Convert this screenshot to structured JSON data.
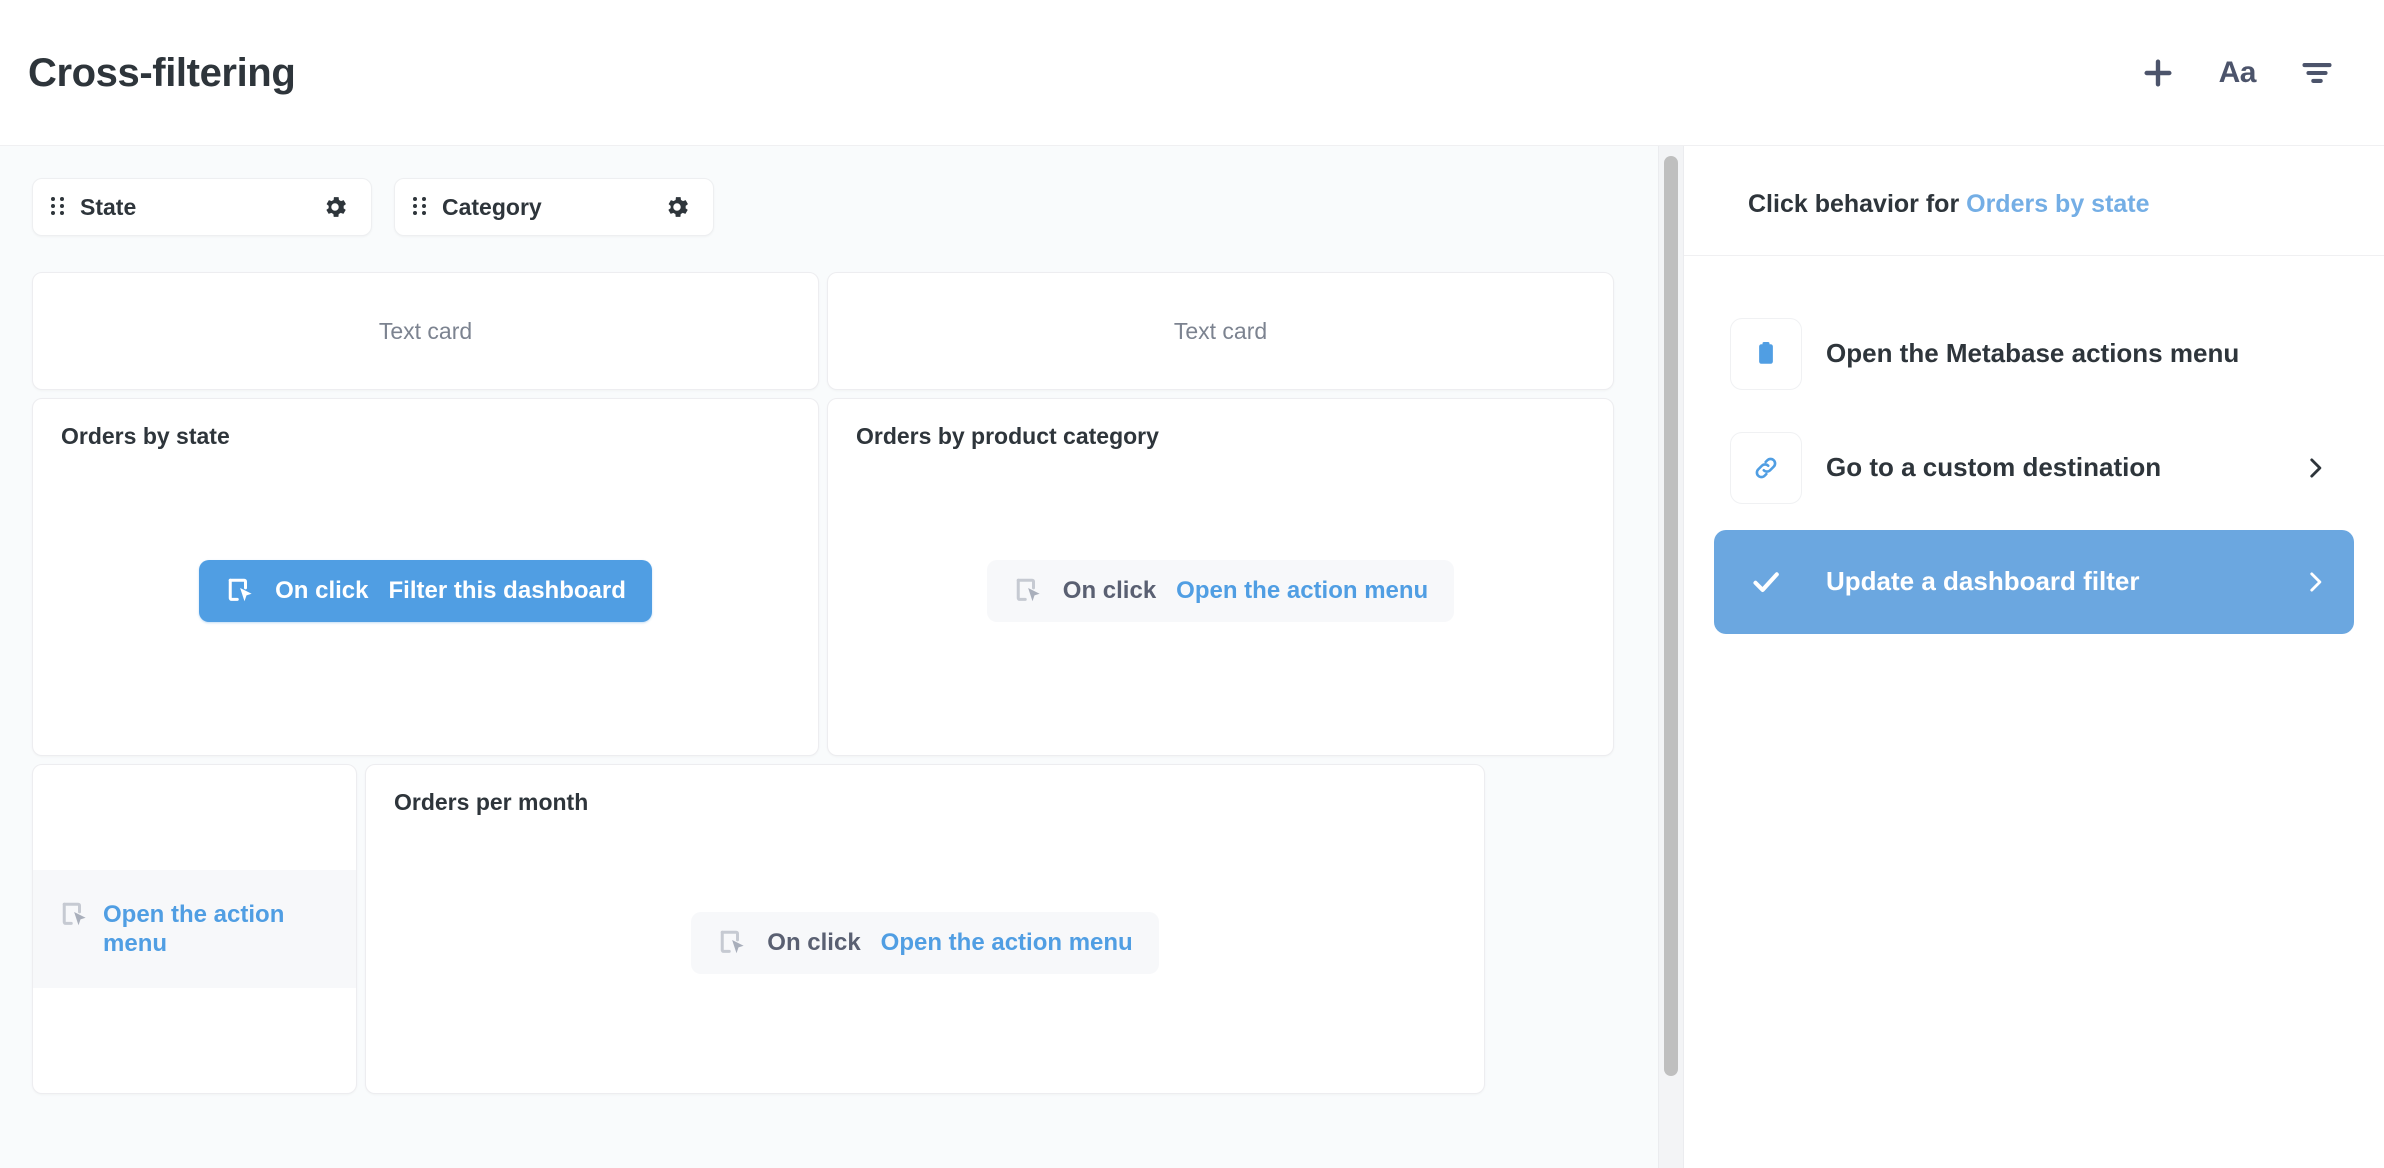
{
  "header": {
    "title": "Cross-filtering",
    "actions": [
      {
        "name": "add-icon",
        "label": "+"
      },
      {
        "name": "text-card-icon",
        "label": "Aa"
      },
      {
        "name": "filter-icon",
        "label": ""
      }
    ]
  },
  "filters": [
    {
      "label": "State",
      "drag_icon": "grip-icon",
      "settings_icon": "gear-icon"
    },
    {
      "label": "Category",
      "drag_icon": "grip-icon",
      "settings_icon": "gear-icon"
    }
  ],
  "dashboard": {
    "text_cards": [
      {
        "label": "Text card"
      },
      {
        "label": "Text card"
      }
    ],
    "cards": [
      {
        "title": "Orders by state",
        "click_behavior": {
          "prefix": "On click",
          "value": "Filter this dashboard",
          "state": "active",
          "icon": "click-cursor-icon"
        }
      },
      {
        "title": "Orders by product category",
        "click_behavior": {
          "prefix": "On click",
          "value": "Open the action menu",
          "state": "inactive",
          "icon": "click-cursor-icon"
        }
      },
      {
        "title": "",
        "click_behavior": {
          "prefix": "",
          "value": "Open the action menu",
          "state": "inactive-narrow",
          "icon": "click-cursor-icon"
        }
      },
      {
        "title": "Orders per month",
        "click_behavior": {
          "prefix": "On click",
          "value": "Open the action menu",
          "state": "inactive",
          "icon": "click-cursor-icon"
        }
      }
    ]
  },
  "sidebar": {
    "heading_prefix": "Click behavior for ",
    "heading_subject": "Orders by state",
    "options": [
      {
        "label": "Open the Metabase actions menu",
        "icon": "actions-menu-icon",
        "selected": false,
        "has_chevron": false
      },
      {
        "label": "Go to a custom destination",
        "icon": "link-icon",
        "selected": false,
        "has_chevron": true
      },
      {
        "label": "Update a dashboard filter",
        "icon": "check-icon",
        "selected": true,
        "has_chevron": true
      }
    ]
  },
  "colors": {
    "brand_blue": "#509EE3",
    "selected_blue": "#6BA7E0",
    "link_blue": "#74AEE5",
    "text_dark": "#2e353b",
    "text_muted": "#7c8390",
    "canvas": "#f9fbfc"
  },
  "scrollbar": {
    "name": "dashboard-scrollbar"
  }
}
